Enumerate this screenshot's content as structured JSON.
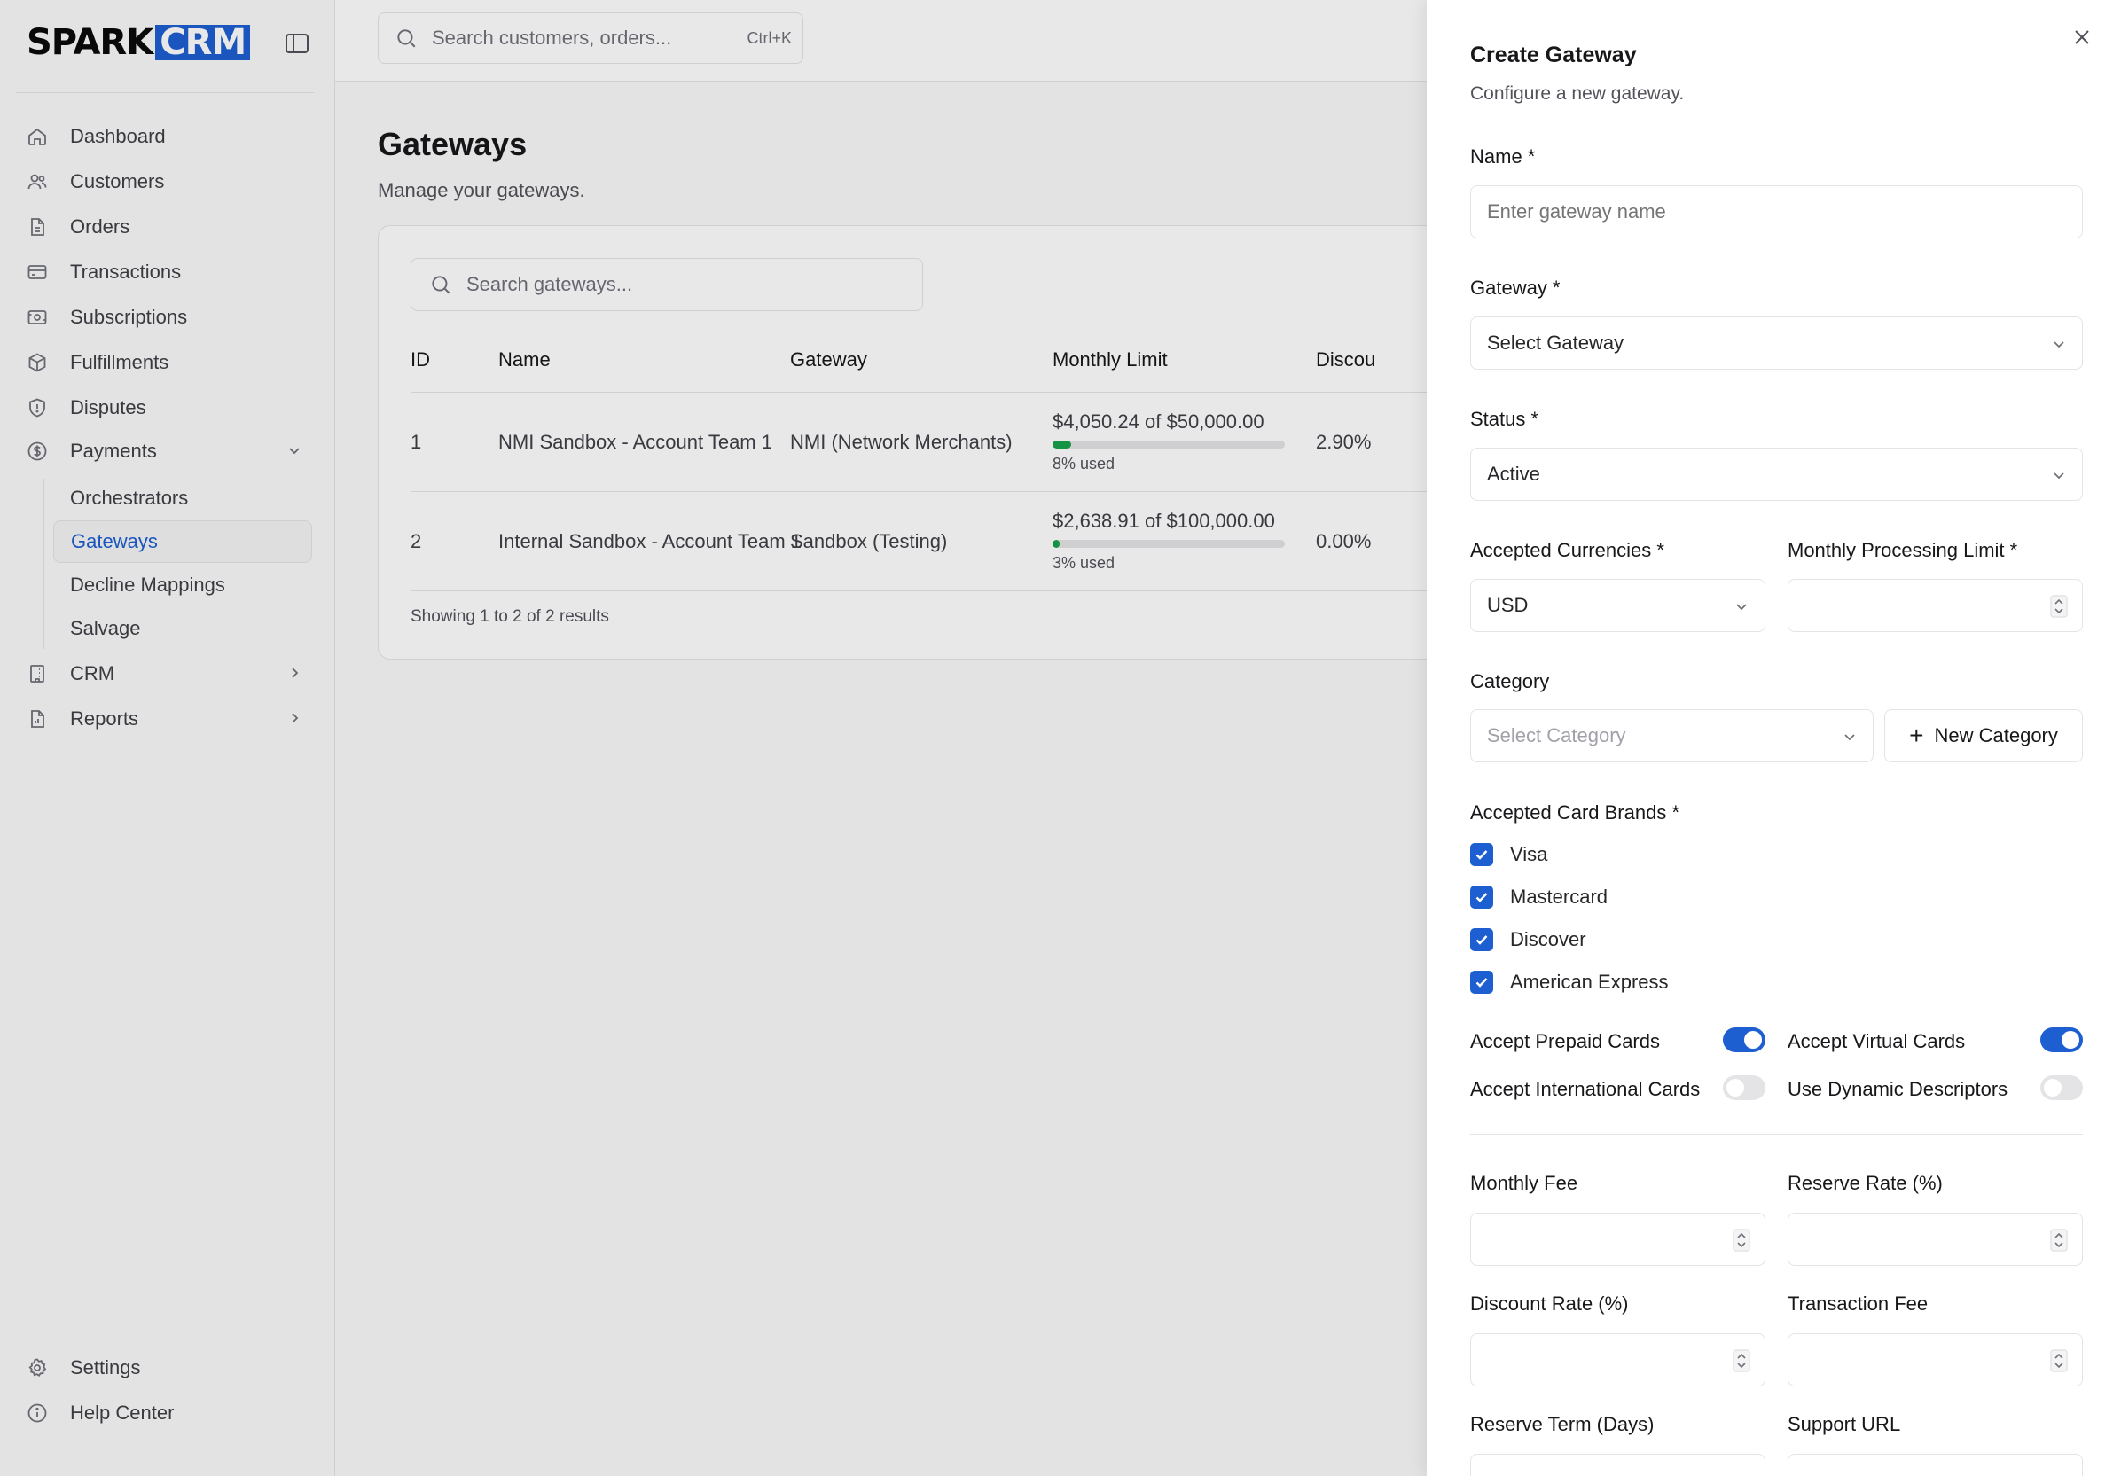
{
  "brand": {
    "part1": "SPARK",
    "part2": "CRM"
  },
  "sidebar": {
    "items": [
      {
        "label": "Dashboard",
        "icon": "home-icon"
      },
      {
        "label": "Customers",
        "icon": "users-icon"
      },
      {
        "label": "Orders",
        "icon": "file-icon"
      },
      {
        "label": "Transactions",
        "icon": "credit-card-icon"
      },
      {
        "label": "Subscriptions",
        "icon": "banknote-icon"
      },
      {
        "label": "Fulfillments",
        "icon": "package-icon"
      },
      {
        "label": "Disputes",
        "icon": "shield-icon"
      },
      {
        "label": "Payments",
        "icon": "dollar-circle-icon"
      }
    ],
    "payments_sub": [
      "Orchestrators",
      "Gateways",
      "Decline Mappings",
      "Salvage"
    ],
    "items_after": [
      {
        "label": "CRM",
        "icon": "building-icon"
      },
      {
        "label": "Reports",
        "icon": "report-icon"
      }
    ],
    "bottom": [
      {
        "label": "Settings",
        "icon": "gear-icon"
      },
      {
        "label": "Help Center",
        "icon": "info-icon"
      }
    ]
  },
  "search": {
    "placeholder": "Search customers, orders...",
    "shortcut": "Ctrl+K"
  },
  "page": {
    "title": "Gateways",
    "subtitle": "Manage your gateways."
  },
  "table": {
    "search_placeholder": "Search gateways...",
    "headers": [
      "ID",
      "Name",
      "Gateway",
      "Monthly Limit",
      "Discou"
    ],
    "rows": [
      {
        "id": "1",
        "name": "NMI Sandbox - Account Team 1",
        "gateway": "NMI (Network Merchants)",
        "used_amt": "$4,050.24",
        "of": "of",
        "limit": "$50,000.00",
        "used_label": "8% used",
        "used_pct": 8,
        "discount": "2.90%"
      },
      {
        "id": "2",
        "name": "Internal Sandbox - Account Team 1",
        "gateway": "Sandbox (Testing)",
        "used_amt": "$2,638.91",
        "of": "of",
        "limit": "$100,000.00",
        "used_label": "3% used",
        "used_pct": 3,
        "discount": "0.00%"
      }
    ],
    "footer": "Showing 1 to 2 of 2 results"
  },
  "drawer": {
    "title": "Create Gateway",
    "subtitle": "Configure a new gateway.",
    "name_label": "Name *",
    "name_placeholder": "Enter gateway name",
    "gateway_label": "Gateway *",
    "gateway_value": "Select Gateway",
    "status_label": "Status *",
    "status_value": "Active",
    "currencies_label": "Accepted Currencies *",
    "currencies_value": "USD",
    "limit_label": "Monthly Processing Limit *",
    "category_label": "Category",
    "category_placeholder": "Select Category",
    "new_category": "New Category",
    "card_brands_label": "Accepted Card Brands *",
    "card_brands": [
      "Visa",
      "Mastercard",
      "Discover",
      "American Express"
    ],
    "toggles": [
      {
        "label": "Accept Prepaid Cards",
        "on": true
      },
      {
        "label": "Accept Virtual Cards",
        "on": true
      },
      {
        "label": "Accept International Cards",
        "on": false
      },
      {
        "label": "Use Dynamic Descriptors",
        "on": false
      }
    ],
    "monthly_fee_label": "Monthly Fee",
    "reserve_rate_label": "Reserve Rate (%)",
    "discount_rate_label": "Discount Rate (%)",
    "transaction_fee_label": "Transaction Fee",
    "reserve_term_label": "Reserve Term (Days)",
    "support_url_label": "Support URL"
  },
  "colors": {
    "accent": "#1d5fd1",
    "progress": "#16a34a"
  }
}
